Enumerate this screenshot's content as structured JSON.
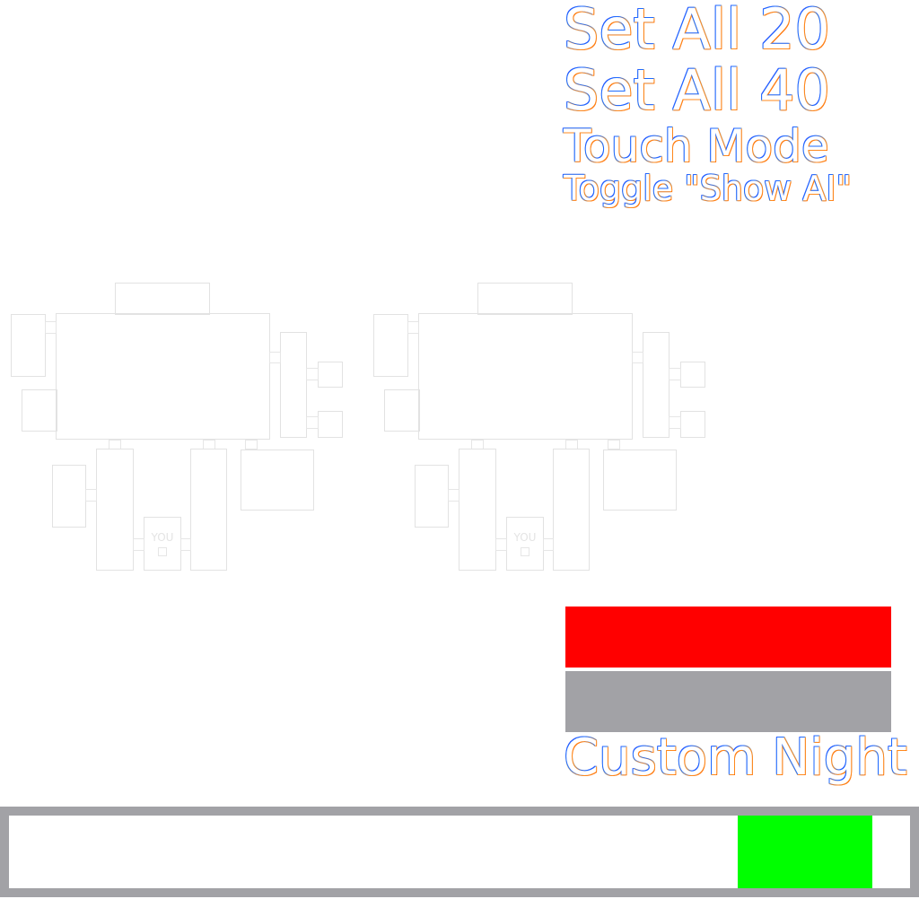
{
  "menu": {
    "set_all_20": "Set All 20",
    "set_all_40": "Set All 40",
    "touch_mode": "Touch Mode",
    "toggle_show_ai": "Toggle \"Show AI\"",
    "custom_night": "Custom Night"
  },
  "maps": [
    {
      "you_label": "YOU"
    },
    {
      "you_label": "YOU"
    }
  ],
  "colors": {
    "red_bar": "#ff0000",
    "gray_bar": "#a2a2a6",
    "green_block": "#00ff00",
    "map_outline": "#e2e2e2"
  }
}
